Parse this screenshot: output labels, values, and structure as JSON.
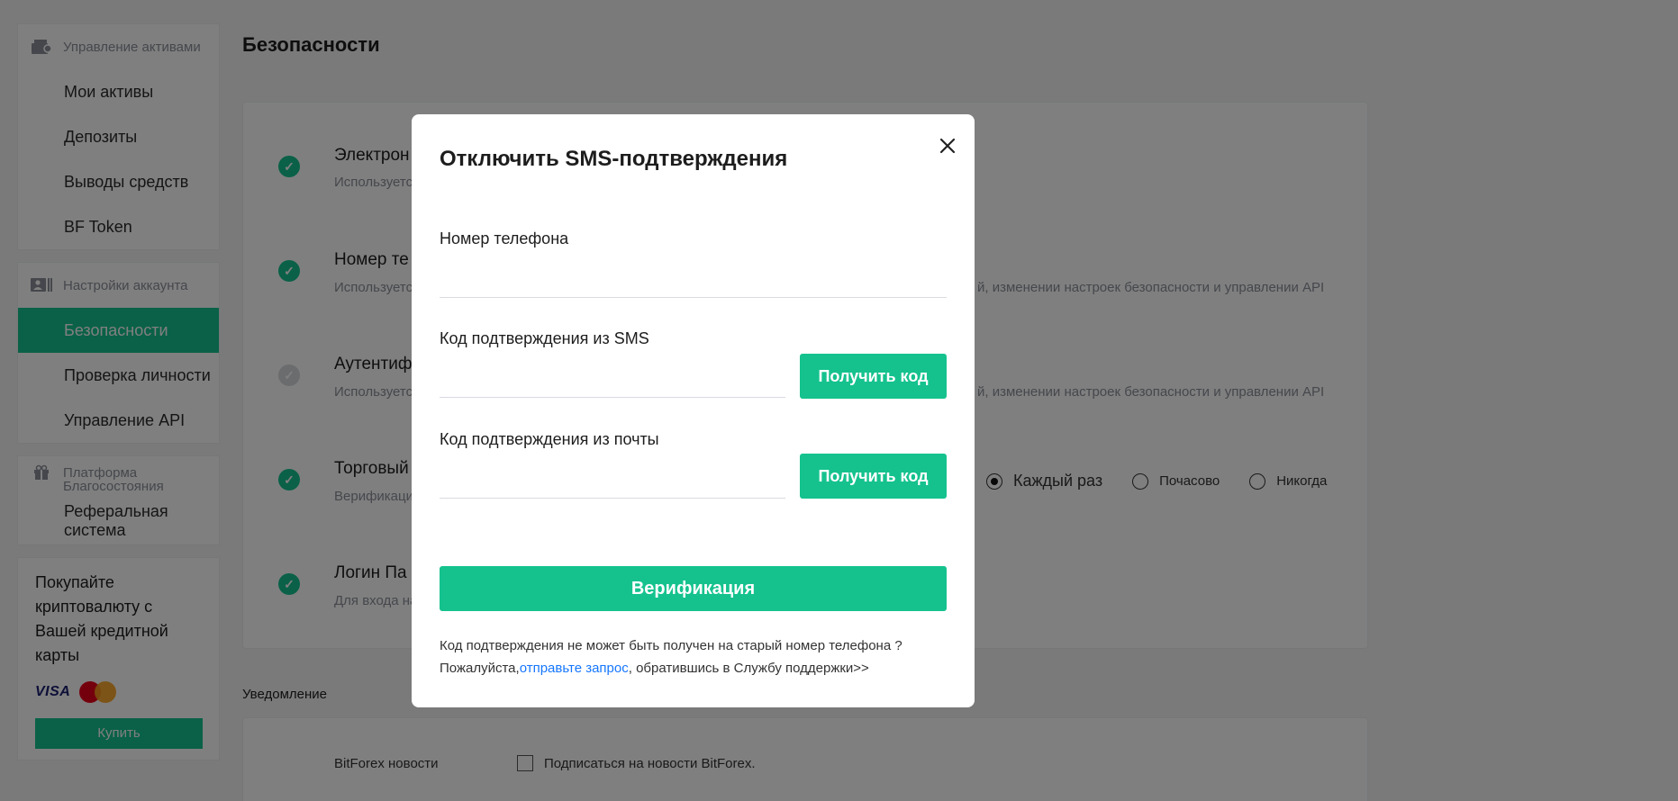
{
  "sidebar": {
    "assets_header": "Управление активами",
    "assets_items": [
      "Мои активы",
      "Депозиты",
      "Выводы средств",
      "BF Token"
    ],
    "account_header": "Настройки аккаунта",
    "account_items": [
      "Безопасности",
      "Проверка личности",
      "Управление API"
    ],
    "welfare_header": "Платформа Благосостояния",
    "welfare_item": "Реферальная система",
    "promo_text": "Покупайте криптовалюту с Вашей кредитной карты",
    "visa_label": "VISA",
    "buy_label": "Купить"
  },
  "page": {
    "title": "Безопасности",
    "rows": [
      {
        "title": "Электрон",
        "desc": "Используется"
      },
      {
        "title": "Номер те",
        "desc": "Используется",
        "desc_right": "й, изменении настроек безопасности и управлении API"
      },
      {
        "title": "Аутентиф",
        "desc": "Используется",
        "desc_right": "й, изменении настроек безопасности и управлении API"
      },
      {
        "title": "Торговый",
        "desc": "Верификаци"
      },
      {
        "title": "Логин Па",
        "desc": "Для входа на"
      }
    ],
    "radio_options": [
      "Каждый раз",
      "Почасово",
      "Никогда"
    ],
    "notification_title": "Уведомление",
    "notification_label": "BitForex новости",
    "notification_checkbox": "Подписаться на новости BitForex."
  },
  "modal": {
    "title": "Отключить SMS-подтверждения",
    "phone_label": "Номер телефона",
    "phone_value": "",
    "sms_label": "Код подтверждения из SMS",
    "sms_value": "",
    "email_label": "Код подтверждения из почты",
    "email_value": "",
    "get_code_label": "Получить код",
    "verify_label": "Верификация",
    "help_line1": "Код подтверждения не может быть получен на старый номер телефона ?",
    "help_prefix": "Пожалуйста,",
    "help_link": "отправьте запрос",
    "help_suffix": ", обратившись в Службу поддержки>>"
  },
  "colors": {
    "accent": "#15c28e",
    "link": "#1677ff",
    "overlay": "rgba(0,0,0,0.5)"
  },
  "icons": {
    "assets": "wallet-icon",
    "account": "id-card-icon",
    "welfare": "gift-icon",
    "close": "close-icon",
    "check": "check-circle-icon"
  }
}
